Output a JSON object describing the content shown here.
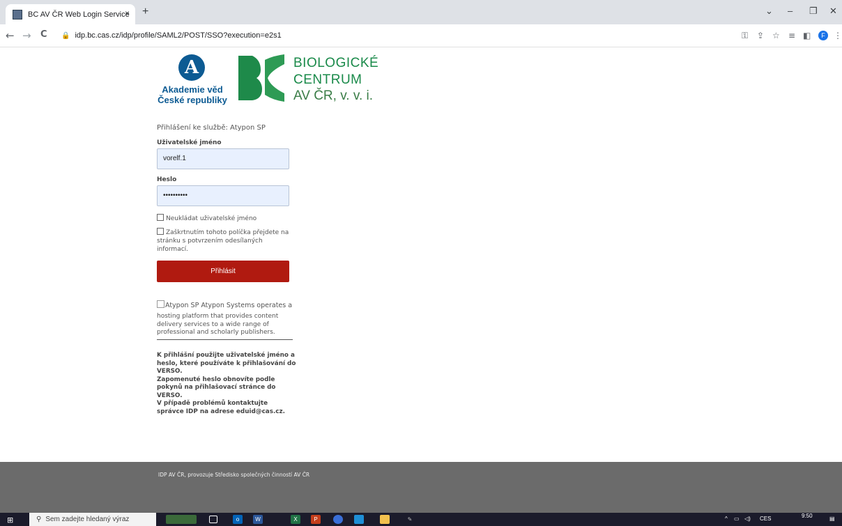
{
  "browser": {
    "tab_title": "BC AV ČR Web Login Service",
    "tab_close": "×",
    "new_tab": "+",
    "url": "idp.bc.cas.cz/idp/profile/SAML2/POST/SSO?execution=e2s1",
    "back": "←",
    "forward": "→",
    "reload": "C",
    "profile_initial": "F"
  },
  "logos": {
    "avcr_mark": "A",
    "avcr_line1": "Akademie věd",
    "avcr_line2": "České republiky",
    "bc_line1": "BIOLOGICKÉ",
    "bc_line2": "CENTRUM",
    "bc_line3": "AV ČR, v. v. i.",
    "accent_blue": "#0d5b93",
    "accent_green": "#1a8a4a"
  },
  "form": {
    "service_label": "Přihlášení ke službě: Atypon SP",
    "username_label": "Uživatelské jméno",
    "username_value": "vorelf.1",
    "password_label": "Heslo",
    "password_value": "••••••••••",
    "remember_label": "Neukládat uživatelské jméno",
    "consent_label": "Zaškrtnutím tohoto políčka přejdete na stránku s potvrzením odesílaných informací.",
    "submit_label": "Přihlásit",
    "submit_color": "#b01a10"
  },
  "sp_info": {
    "image_alt": "Atypon SP Atypon Systems operates a",
    "description": "hosting platform that provides content delivery services to a wide range of professional and scholarly publishers."
  },
  "help": {
    "line1": "K přihlášní použijte uživatelské jméno a heslo, které používáte k přihlašování do VERSO.",
    "line2": "Zapomenuté heslo obnovíte podle pokynů na přihlašovací stránce do VERSO.",
    "line3": "V případě problémů kontaktujte správce IDP na adrese eduid@cas.cz."
  },
  "footer": {
    "text": "IDP AV ČR, provozuje Středisko společných činností AV ČR"
  },
  "taskbar": {
    "search_placeholder": "Sem zadejte hledaný výraz",
    "language": "CES",
    "time": "9:50"
  }
}
